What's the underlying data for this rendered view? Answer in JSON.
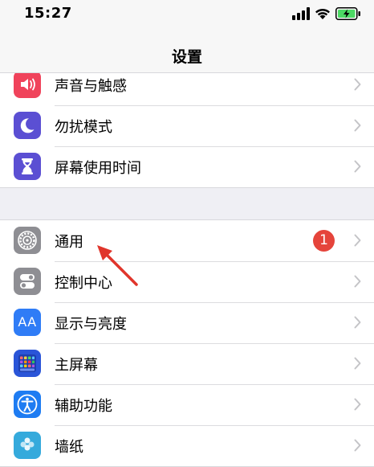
{
  "status_bar": {
    "time": "15:27",
    "icons": [
      "cellular-signal-icon",
      "wifi-icon",
      "battery-charging-icon"
    ],
    "battery_color": "#4cd964"
  },
  "nav": {
    "title": "设置"
  },
  "groups": [
    {
      "items": [
        {
          "label": "声音与触感",
          "icon": "speaker-icon",
          "color": "#f0435b"
        },
        {
          "label": "勿扰模式",
          "icon": "moon-icon",
          "color": "#5b4fd3"
        },
        {
          "label": "屏幕使用时间",
          "icon": "hourglass-icon",
          "color": "#5b4fd3"
        }
      ]
    },
    {
      "items": [
        {
          "label": "通用",
          "icon": "gear-icon",
          "color": "#8e8e93",
          "badge": "1"
        },
        {
          "label": "控制中心",
          "icon": "toggles-icon",
          "color": "#8e8e93"
        },
        {
          "label": "显示与亮度",
          "icon": "text-size-icon",
          "color": "#2f7cf6",
          "icon_text": "AA"
        },
        {
          "label": "主屏幕",
          "icon": "app-grid-icon",
          "color": "#2a55d8"
        },
        {
          "label": "辅助功能",
          "icon": "accessibility-icon",
          "color": "#1e7cf2"
        },
        {
          "label": "墙纸",
          "icon": "wallpaper-icon",
          "color": "#35aadc"
        }
      ]
    }
  ],
  "colors": {
    "badge": "#e5443b",
    "annotation_arrow": "#e0352b",
    "chevron": "#c4c4c7"
  }
}
